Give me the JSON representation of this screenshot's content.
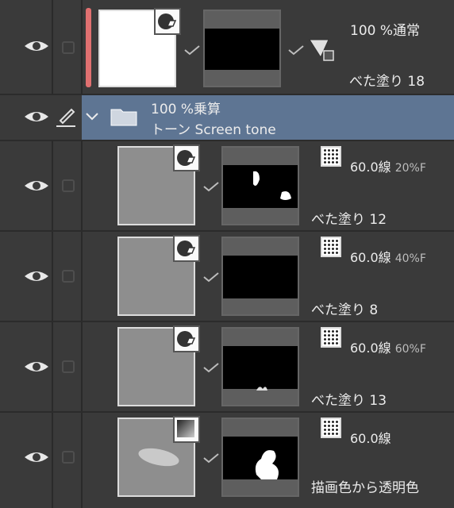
{
  "layers": [
    {
      "opacity_blend": "100 %通常",
      "name": "べた塗り 18",
      "selected_marker_color": "#e07070"
    },
    {
      "group_line1": "100 %乗算",
      "group_line2": "トーン Screen tone"
    },
    {
      "tone": "60.0線",
      "tone_extra": "20%F",
      "name": "べた塗り 12"
    },
    {
      "tone": "60.0線",
      "tone_extra": "40%F",
      "name": "べた塗り 8"
    },
    {
      "tone": "60.0線",
      "tone_extra": "60%F",
      "name": "べた塗り 13"
    },
    {
      "tone": "60.0線",
      "tone_extra": "",
      "name": "描画色から透明色"
    }
  ],
  "colors": {
    "panel_bg": "#3a3a3a",
    "group_bg": "#5e7593",
    "accent_marker": "#e07070"
  },
  "icons": [
    "eye-icon",
    "pen-icon",
    "chevron-down-icon",
    "folder-icon",
    "checkmark-icon",
    "color-badge-icon",
    "tone-texture-icon"
  ]
}
